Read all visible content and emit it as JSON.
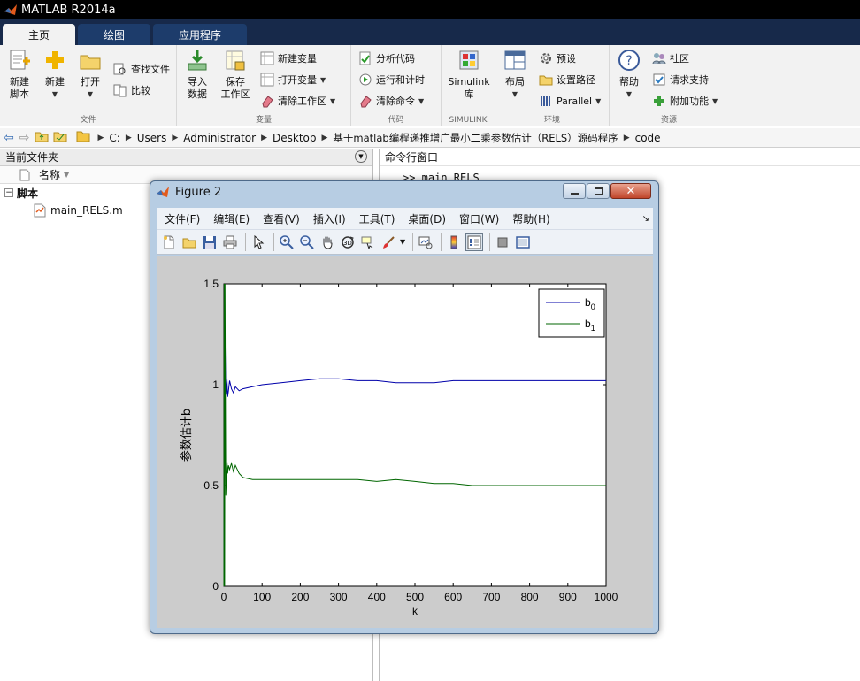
{
  "app": {
    "title": "MATLAB R2014a"
  },
  "ribbon_tabs": [
    "主页",
    "绘图",
    "应用程序"
  ],
  "ribbon": {
    "file": {
      "label": "文件",
      "new_script": "新建\n脚本",
      "new": "新建",
      "open": "打开",
      "find_files": "查找文件",
      "compare": "比较"
    },
    "variable": {
      "label": "变量",
      "import": "导入\n数据",
      "save": "保存\n工作区",
      "new_var": "新建变量",
      "open_var": "打开变量",
      "clear_ws": "清除工作区"
    },
    "code": {
      "label": "代码",
      "analyze": "分析代码",
      "run_time": "运行和计时",
      "clear_cmd": "清除命令"
    },
    "simulink": {
      "label": "SIMULINK",
      "lib": "Simulink\n库"
    },
    "env": {
      "label": "环境",
      "layout": "布局",
      "prefs": "预设",
      "set_path": "设置路径",
      "parallel": "Parallel"
    },
    "resources": {
      "label": "资源",
      "help": "帮助",
      "community": "社区",
      "support": "请求支持",
      "addons": "附加功能"
    }
  },
  "breadcrumb": [
    "C:",
    "Users",
    "Administrator",
    "Desktop",
    "基于matlab编程递推增广最小二乘参数估计（RELS）源码程序",
    "code"
  ],
  "left_panel": {
    "title": "当前文件夹",
    "col_name": "名称",
    "group": "脚本",
    "files": [
      "main_RELS.m"
    ]
  },
  "command_window": {
    "title": "命令行窗口",
    "line": ">> main_RELS"
  },
  "figure": {
    "title": "Figure 2",
    "menu": [
      "文件(F)",
      "编辑(E)",
      "查看(V)",
      "插入(I)",
      "工具(T)",
      "桌面(D)",
      "窗口(W)",
      "帮助(H)"
    ]
  },
  "colors": {
    "b0": "#0000aa",
    "b1": "#006600",
    "ribbon_dark": "#17294a"
  },
  "chart_data": {
    "type": "line",
    "xlabel": "k",
    "ylabel": "参数估计b",
    "xlim": [
      0,
      1000
    ],
    "ylim": [
      0,
      1.5
    ],
    "xticks": [
      "0",
      "100",
      "200",
      "300",
      "400",
      "500",
      "600",
      "700",
      "800",
      "900",
      "1000"
    ],
    "yticks": [
      "0",
      "0.5",
      "1",
      "1.5"
    ],
    "legend": {
      "position": "top-right",
      "entries": [
        "b",
        "b"
      ],
      "subscripts": [
        "0",
        "1"
      ]
    },
    "series": [
      {
        "name": "b0",
        "x": [
          0,
          3,
          5,
          8,
          10,
          12,
          15,
          20,
          25,
          30,
          40,
          50,
          75,
          100,
          150,
          200,
          250,
          300,
          350,
          400,
          450,
          500,
          550,
          600,
          650,
          700,
          750,
          800,
          850,
          900,
          950,
          1000
        ],
        "y": [
          0,
          1.25,
          0.95,
          1.03,
          0.94,
          0.97,
          1.02,
          0.98,
          0.96,
          0.99,
          0.97,
          0.98,
          0.99,
          1.0,
          1.01,
          1.02,
          1.03,
          1.03,
          1.02,
          1.02,
          1.01,
          1.01,
          1.01,
          1.02,
          1.02,
          1.02,
          1.02,
          1.02,
          1.02,
          1.02,
          1.02,
          1.02
        ]
      },
      {
        "name": "b1",
        "x": [
          0,
          1,
          2,
          3,
          5,
          8,
          10,
          12,
          15,
          20,
          25,
          30,
          40,
          50,
          75,
          100,
          150,
          200,
          250,
          300,
          350,
          400,
          450,
          500,
          550,
          600,
          650,
          700,
          750,
          800,
          850,
          900,
          950,
          1000
        ],
        "y": [
          0,
          1.5,
          0.0,
          1.5,
          0.45,
          0.62,
          0.56,
          0.6,
          0.58,
          0.61,
          0.57,
          0.6,
          0.56,
          0.54,
          0.53,
          0.53,
          0.53,
          0.53,
          0.53,
          0.53,
          0.53,
          0.52,
          0.53,
          0.52,
          0.51,
          0.51,
          0.5,
          0.5,
          0.5,
          0.5,
          0.5,
          0.5,
          0.5,
          0.5
        ]
      }
    ]
  }
}
